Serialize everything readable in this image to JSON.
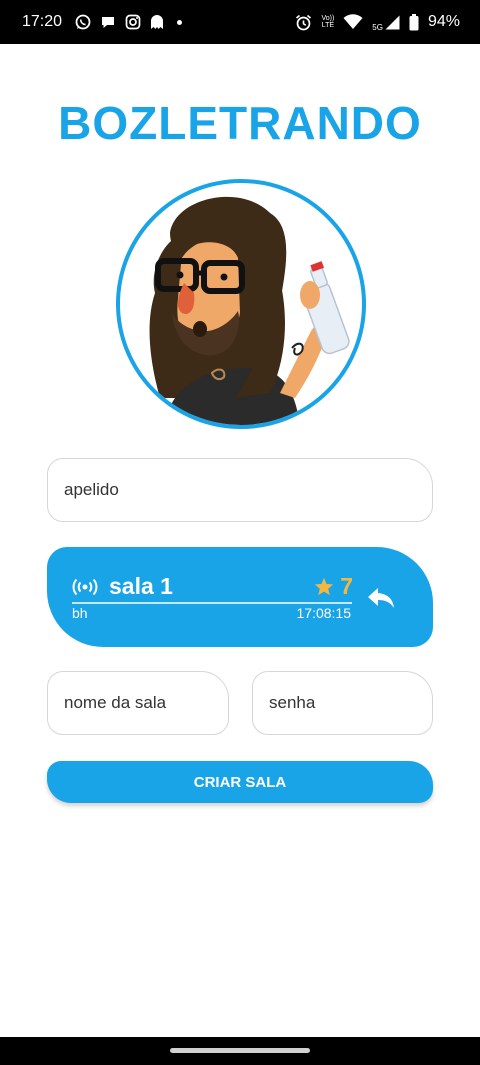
{
  "status_bar": {
    "time": "17:20",
    "left_icons": [
      "whatsapp-icon",
      "chat-bubble-icon",
      "instagram-icon",
      "ghost-icon",
      "notification-dot-icon"
    ],
    "right_icons": [
      "alarm-icon",
      "volte-icon",
      "wifi-icon",
      "signal-icon",
      "battery-icon"
    ],
    "volte_line1": "Vo))",
    "volte_line2": "LTE",
    "network": "5G",
    "battery": "94%"
  },
  "app": {
    "title": "BOZLETRANDO"
  },
  "avatar": {
    "icon": "caricature-avatar-icon"
  },
  "nickname": {
    "placeholder": "apelido"
  },
  "room_card": {
    "icon": "broadcast-icon",
    "name": "sala 1",
    "rating": "7",
    "rating_icon": "star-icon",
    "user": "bh",
    "time": "17:08:15",
    "action_icon": "reply-icon"
  },
  "new_room": {
    "name_placeholder": "nome da sala",
    "password_placeholder": "senha",
    "create_label": "CRIAR SALA"
  },
  "colors": {
    "accent": "#1aa4e8",
    "star": "#f5b83f",
    "background": "#ffffff",
    "system_bars": "#000000"
  }
}
